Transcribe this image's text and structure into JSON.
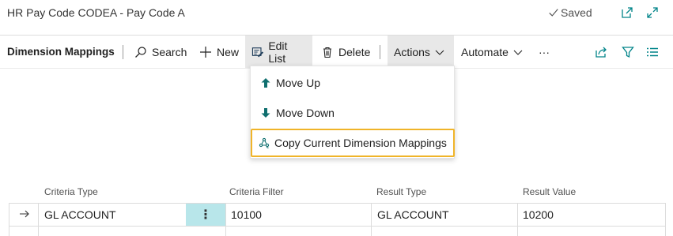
{
  "header": {
    "title": "HR Pay Code CODEA - Pay Code A",
    "status": "Saved"
  },
  "actionbar": {
    "page_name": "Dimension Mappings",
    "search_label": "Search",
    "new_label": "New",
    "edit_list_label": "Edit List",
    "delete_label": "Delete",
    "actions_label": "Actions",
    "automate_label": "Automate",
    "more_label": "···"
  },
  "menu": {
    "items": [
      {
        "label": "Move Up",
        "icon": "arrow-up-icon"
      },
      {
        "label": "Move Down",
        "icon": "arrow-down-icon"
      },
      {
        "label": "Copy Current Dimension Mappings",
        "icon": "copy-mappings-icon"
      }
    ]
  },
  "grid": {
    "columns": [
      "Criteria Type",
      "Criteria Filter",
      "Result Type",
      "Result Value"
    ],
    "rows": [
      {
        "criteria_type": "GL ACCOUNT",
        "criteria_filter": "10100",
        "result_type": "GL ACCOUNT",
        "result_value": "10200"
      }
    ],
    "row_menu_label": "⋮"
  },
  "colors": {
    "accent": "#008489",
    "focus": "#f0b429",
    "selected_cell": "#b8e6ea"
  }
}
